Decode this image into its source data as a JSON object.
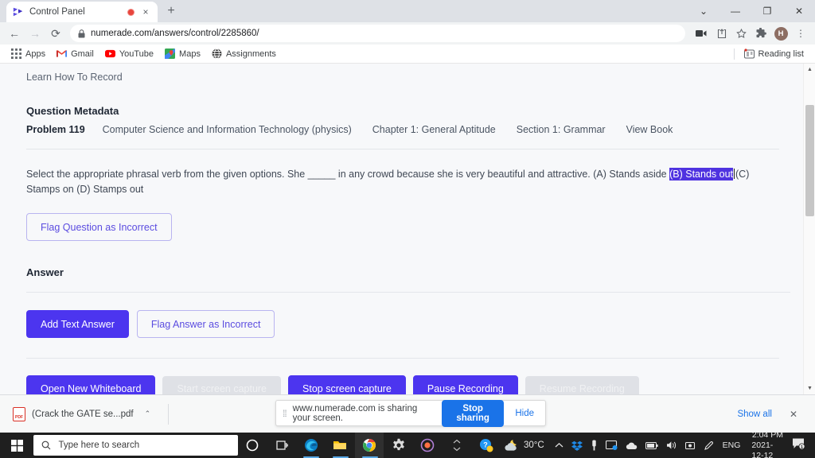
{
  "browser": {
    "tab": {
      "title": "Control Panel",
      "favicon": "numerade-logo-icon",
      "recording_indicator": "recording-dot-icon",
      "close": "×"
    },
    "newtab_label": "+",
    "window_controls": {
      "more": "⌄",
      "minimize": "—",
      "maximize": "❐",
      "close": "✕"
    },
    "nav": {
      "back": "←",
      "forward": "→",
      "reload": "⟳"
    },
    "omnibox": {
      "lock": "🔒",
      "url": "numerade.com/answers/control/2285860/"
    },
    "toolbar_icons": {
      "cast": "cast-icon",
      "share": "share-icon",
      "bookmark": "star-icon",
      "extensions": "puzzle-icon",
      "profile_initial": "H",
      "menu": "⋮"
    },
    "bookmarks": [
      {
        "label": "Apps",
        "icon": "apps-grid-icon"
      },
      {
        "label": "Gmail",
        "icon": "gmail-icon"
      },
      {
        "label": "YouTube",
        "icon": "youtube-icon"
      },
      {
        "label": "Maps",
        "icon": "maps-icon"
      },
      {
        "label": "Assignments",
        "icon": "globe-icon"
      }
    ],
    "reading_list": {
      "label": "Reading list",
      "icon": "reading-list-icon"
    }
  },
  "page": {
    "learn_link": "Learn How To Record",
    "metadata": {
      "heading": "Question Metadata",
      "problem": "Problem 119",
      "subject": "Computer Science and Information Technology (physics)",
      "chapter": "Chapter 1: General Aptitude",
      "section": "Section 1: Grammar",
      "view_book": "View Book"
    },
    "question": {
      "before": "Select the appropriate phrasal verb from the given options. She _____ in any crowd because she is very beautiful and attractive. (A) Stands aside ",
      "selected": "(B) Stands out",
      "after": "(C) Stamps on (D) Stamps out"
    },
    "flag_question_button": "Flag Question as Incorrect",
    "answer_heading": "Answer",
    "add_text_answer_button": "Add Text Answer",
    "flag_answer_button": "Flag Answer as Incorrect",
    "recording_buttons": [
      {
        "label": "Open New Whiteboard",
        "state": "enabled"
      },
      {
        "label": "Start screen capture",
        "state": "disabled"
      },
      {
        "label": "Stop screen capture",
        "state": "enabled"
      },
      {
        "label": "Pause Recording",
        "state": "enabled"
      },
      {
        "label": "Resume Recording",
        "state": "disabled"
      }
    ]
  },
  "share_bar": {
    "grip": "⁞⁞",
    "message": "www.numerade.com is sharing your screen.",
    "stop_button": "Stop sharing",
    "hide_button": "Hide"
  },
  "download_shelf": {
    "file_name": "(Crack the GATE se...pdf",
    "file_icon": "pdf-file-icon",
    "caret": "⌃",
    "show_all": "Show all",
    "close": "✕"
  },
  "taskbar": {
    "start_icon": "windows-logo-icon",
    "search_placeholder": "Type here to search",
    "search_icon": "search-icon",
    "items": [
      {
        "name": "cortana-icon"
      },
      {
        "name": "task-view-icon"
      },
      {
        "name": "edge-icon"
      },
      {
        "name": "file-explorer-icon"
      },
      {
        "name": "chrome-icon"
      },
      {
        "name": "settings-icon"
      },
      {
        "name": "media-player-icon"
      }
    ],
    "weather": {
      "temperature": "30°C",
      "icon": "partly-cloudy-night-icon"
    },
    "tray_icons": [
      "chevron-up-icon",
      "dropbox-icon",
      "usb-icon",
      "display-icon",
      "onedrive-icon",
      "battery-icon",
      "volume-icon",
      "camera-icon",
      "pen-icon"
    ],
    "language": "ENG",
    "clock": {
      "time": "2:04 PM",
      "date": "2021-12-12"
    },
    "notification": {
      "icon": "notification-icon",
      "count": "1"
    }
  },
  "colors": {
    "accent_purple": "#4c35ef",
    "selection_purple": "#4f33e0",
    "chrome_blue": "#1a73e8",
    "disabled_gray": "#dfe1e6"
  }
}
